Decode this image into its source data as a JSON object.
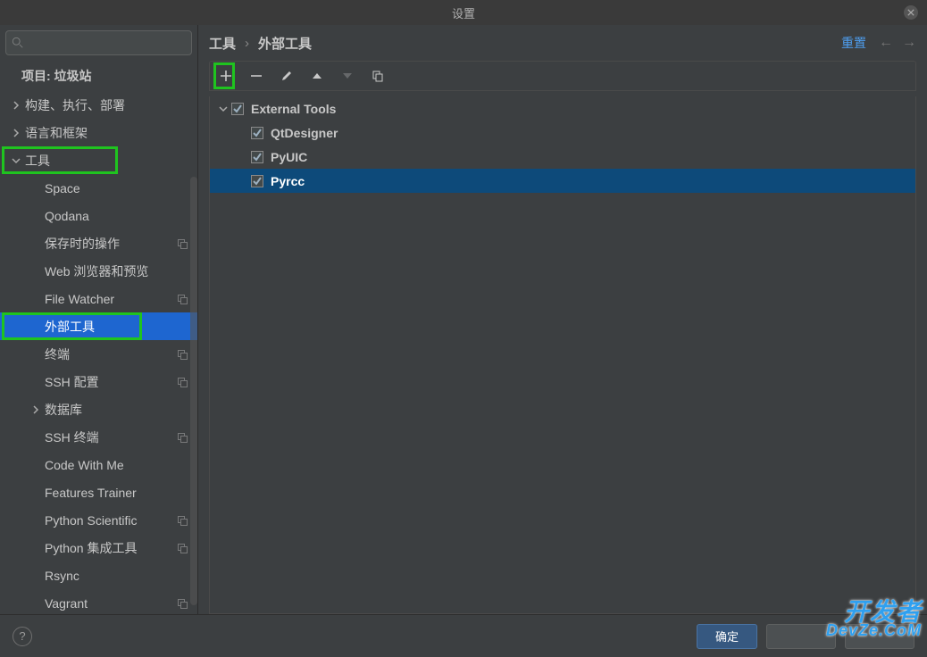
{
  "title": "设置",
  "search": {
    "placeholder": ""
  },
  "sidebar": {
    "project_label": "项目: 垃圾站",
    "items": [
      {
        "label": "构建、执行、部署",
        "indent": 0,
        "chevron": "right"
      },
      {
        "label": "语言和框架",
        "indent": 0,
        "chevron": "right"
      },
      {
        "label": "工具",
        "indent": 0,
        "chevron": "down",
        "highlight": true
      },
      {
        "label": "Space",
        "indent": 1
      },
      {
        "label": "Qodana",
        "indent": 1
      },
      {
        "label": "保存时的操作",
        "indent": 1,
        "badge": true
      },
      {
        "label": "Web 浏览器和预览",
        "indent": 1
      },
      {
        "label": "File Watcher",
        "indent": 1,
        "badge": true
      },
      {
        "label": "外部工具",
        "indent": 1,
        "selected": true,
        "highlight": true
      },
      {
        "label": "终端",
        "indent": 1,
        "badge": true
      },
      {
        "label": "SSH 配置",
        "indent": 1,
        "badge": true
      },
      {
        "label": "数据库",
        "indent": 1,
        "chevron": "right"
      },
      {
        "label": "SSH 终端",
        "indent": 1,
        "badge": true
      },
      {
        "label": "Code With Me",
        "indent": 1
      },
      {
        "label": "Features Trainer",
        "indent": 1
      },
      {
        "label": "Python Scientific",
        "indent": 1,
        "badge": true
      },
      {
        "label": "Python 集成工具",
        "indent": 1,
        "badge": true
      },
      {
        "label": "Rsync",
        "indent": 1
      },
      {
        "label": "Vagrant",
        "indent": 1,
        "badge": true
      }
    ]
  },
  "breadcrumb": {
    "root": "工具",
    "leaf": "外部工具"
  },
  "reset_label": "重置",
  "tree": {
    "group": "External Tools",
    "items": [
      {
        "label": "QtDesigner",
        "checked": true
      },
      {
        "label": "PyUIC",
        "checked": true
      },
      {
        "label": "Pyrcc",
        "checked": true,
        "selected": true
      }
    ]
  },
  "footer": {
    "ok": "确定"
  },
  "watermark": {
    "top": "开发者",
    "bottom": "DevZe.CoM"
  }
}
